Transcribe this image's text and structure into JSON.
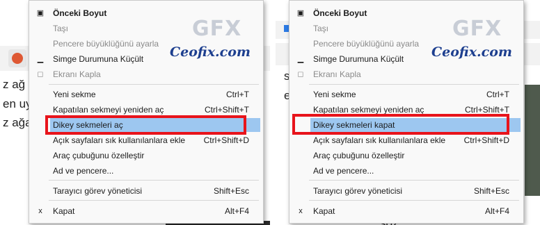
{
  "watermark": {
    "logo": "GFX",
    "site": "Ceofix.com"
  },
  "background": {
    "left_text": [
      "z ağ",
      "en uy",
      "z ağa"
    ],
    "right_text": [
      "so",
      "eni",
      "söz"
    ]
  },
  "menu_left": {
    "items": [
      {
        "label": "Önceki Boyut",
        "accel": "",
        "icon": "▣",
        "bold": true,
        "disabled": false
      },
      {
        "label": "Taşı",
        "accel": "",
        "icon": "",
        "bold": false,
        "disabled": true
      },
      {
        "label": "Pencere büyüklüğünü ayarla",
        "accel": "",
        "icon": "",
        "bold": false,
        "disabled": true
      },
      {
        "label": "Simge Durumuna Küçült",
        "accel": "",
        "icon": "▁",
        "bold": false,
        "disabled": false
      },
      {
        "label": "Ekranı Kapla",
        "accel": "",
        "icon": "◻",
        "bold": false,
        "disabled": true
      },
      {
        "label": "Yeni sekme",
        "accel": "Ctrl+T",
        "icon": "",
        "bold": false,
        "disabled": false
      },
      {
        "label": "Kapatılan sekmeyi yeniden aç",
        "accel": "Ctrl+Shift+T",
        "icon": "",
        "bold": false,
        "disabled": false
      },
      {
        "label": "Dikey sekmeleri aç",
        "accel": "",
        "icon": "",
        "bold": false,
        "disabled": false
      },
      {
        "label": "Açık sayfaları sık kullanılanlara ekle",
        "accel": "Ctrl+Shift+D",
        "icon": "",
        "bold": false,
        "disabled": false
      },
      {
        "label": "Araç çubuğunu özelleştir",
        "accel": "",
        "icon": "",
        "bold": false,
        "disabled": false
      },
      {
        "label": "Ad ve pencere...",
        "accel": "",
        "icon": "",
        "bold": false,
        "disabled": false
      },
      {
        "label": "Tarayıcı görev yöneticisi",
        "accel": "Shift+Esc",
        "icon": "",
        "bold": false,
        "disabled": false
      },
      {
        "label": "Kapat",
        "accel": "Alt+F4",
        "icon": "x",
        "bold": false,
        "disabled": false
      }
    ]
  },
  "menu_right": {
    "items": [
      {
        "label": "Önceki Boyut",
        "accel": "",
        "icon": "▣",
        "bold": true,
        "disabled": false
      },
      {
        "label": "Taşı",
        "accel": "",
        "icon": "",
        "bold": false,
        "disabled": true
      },
      {
        "label": "Pencere büyüklüğünü ayarla",
        "accel": "",
        "icon": "",
        "bold": false,
        "disabled": true
      },
      {
        "label": "Simge Durumuna Küçült",
        "accel": "",
        "icon": "▁",
        "bold": false,
        "disabled": false
      },
      {
        "label": "Ekranı Kapla",
        "accel": "",
        "icon": "◻",
        "bold": false,
        "disabled": true
      },
      {
        "label": "Yeni sekme",
        "accel": "Ctrl+T",
        "icon": "",
        "bold": false,
        "disabled": false
      },
      {
        "label": "Kapatılan sekmeyi yeniden aç",
        "accel": "Ctrl+Shift+T",
        "icon": "",
        "bold": false,
        "disabled": false
      },
      {
        "label": "Dikey sekmeleri kapat",
        "accel": "",
        "icon": "",
        "bold": false,
        "disabled": false
      },
      {
        "label": "Açık sayfaları sık kullanılanlara ekle",
        "accel": "Ctrl+Shift+D",
        "icon": "",
        "bold": false,
        "disabled": false
      },
      {
        "label": "Araç çubuğunu özelleştir",
        "accel": "",
        "icon": "",
        "bold": false,
        "disabled": false
      },
      {
        "label": "Ad ve pencere...",
        "accel": "",
        "icon": "",
        "bold": false,
        "disabled": false
      },
      {
        "label": "Tarayıcı görev yöneticisi",
        "accel": "Shift+Esc",
        "icon": "",
        "bold": false,
        "disabled": false
      },
      {
        "label": "Kapat",
        "accel": "Alt+F4",
        "icon": "x",
        "bold": false,
        "disabled": false
      }
    ]
  },
  "colors": {
    "highlight": "#9dc7f0",
    "annotation": "#e8141b",
    "brand": "#1d3f8f"
  }
}
